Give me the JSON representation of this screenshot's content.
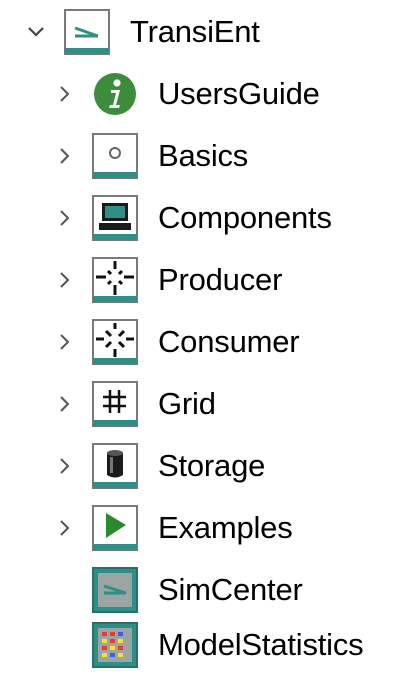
{
  "tree": {
    "root": {
      "label": "TransiEnt",
      "expanded": true,
      "icon": "package-expanded-icon"
    },
    "children": [
      {
        "label": "UsersGuide",
        "icon": "info-icon",
        "expandable": true
      },
      {
        "label": "Basics",
        "icon": "basics-package-icon",
        "expandable": true
      },
      {
        "label": "Components",
        "icon": "components-computer-icon",
        "expandable": true
      },
      {
        "label": "Producer",
        "icon": "producer-icon",
        "expandable": true
      },
      {
        "label": "Consumer",
        "icon": "consumer-icon",
        "expandable": true
      },
      {
        "label": "Grid",
        "icon": "grid-icon",
        "expandable": true
      },
      {
        "label": "Storage",
        "icon": "storage-icon",
        "expandable": true
      },
      {
        "label": "Examples",
        "icon": "examples-play-icon",
        "expandable": true
      },
      {
        "label": "SimCenter",
        "icon": "simcenter-icon",
        "expandable": false
      },
      {
        "label": "ModelStatistics",
        "icon": "model-statistics-icon",
        "expandable": false
      }
    ]
  },
  "colors": {
    "package_teal": "#2f8f86",
    "info_green": "#3b8d3b",
    "chevron_gray": "#555555"
  }
}
